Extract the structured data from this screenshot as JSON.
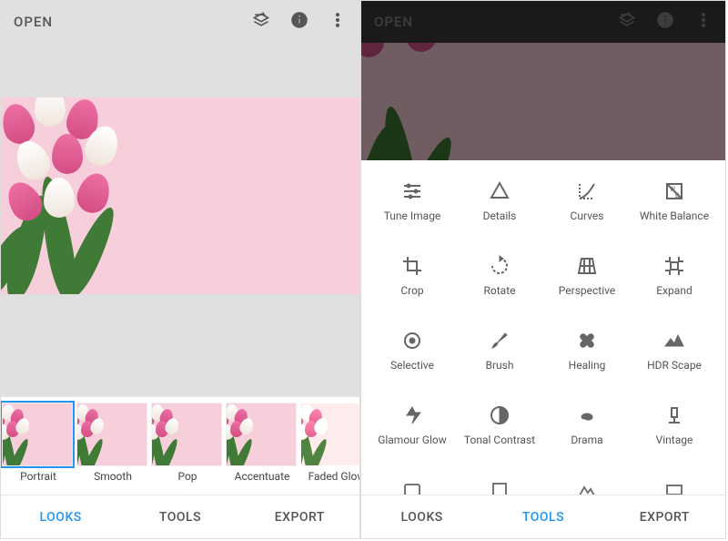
{
  "left": {
    "open_label": "OPEN",
    "looks": [
      {
        "label": "Portrait"
      },
      {
        "label": "Smooth"
      },
      {
        "label": "Pop"
      },
      {
        "label": "Accentuate"
      },
      {
        "label": "Faded Glow"
      }
    ],
    "nav": {
      "looks": "LOOKS",
      "tools": "TOOLS",
      "export": "EXPORT",
      "active": "looks"
    }
  },
  "right": {
    "open_label": "OPEN",
    "tools": [
      {
        "label": "Tune Image",
        "icon": "tune"
      },
      {
        "label": "Details",
        "icon": "details"
      },
      {
        "label": "Curves",
        "icon": "curves"
      },
      {
        "label": "White Balance",
        "icon": "white-balance"
      },
      {
        "label": "Crop",
        "icon": "crop"
      },
      {
        "label": "Rotate",
        "icon": "rotate"
      },
      {
        "label": "Perspective",
        "icon": "perspective"
      },
      {
        "label": "Expand",
        "icon": "expand"
      },
      {
        "label": "Selective",
        "icon": "selective"
      },
      {
        "label": "Brush",
        "icon": "brush"
      },
      {
        "label": "Healing",
        "icon": "healing"
      },
      {
        "label": "HDR Scape",
        "icon": "hdr"
      },
      {
        "label": "Glamour Glow",
        "icon": "glamour"
      },
      {
        "label": "Tonal Contrast",
        "icon": "tonal"
      },
      {
        "label": "Drama",
        "icon": "drama"
      },
      {
        "label": "Vintage",
        "icon": "vintage"
      }
    ],
    "nav": {
      "looks": "LOOKS",
      "tools": "TOOLS",
      "export": "EXPORT",
      "active": "tools"
    }
  }
}
